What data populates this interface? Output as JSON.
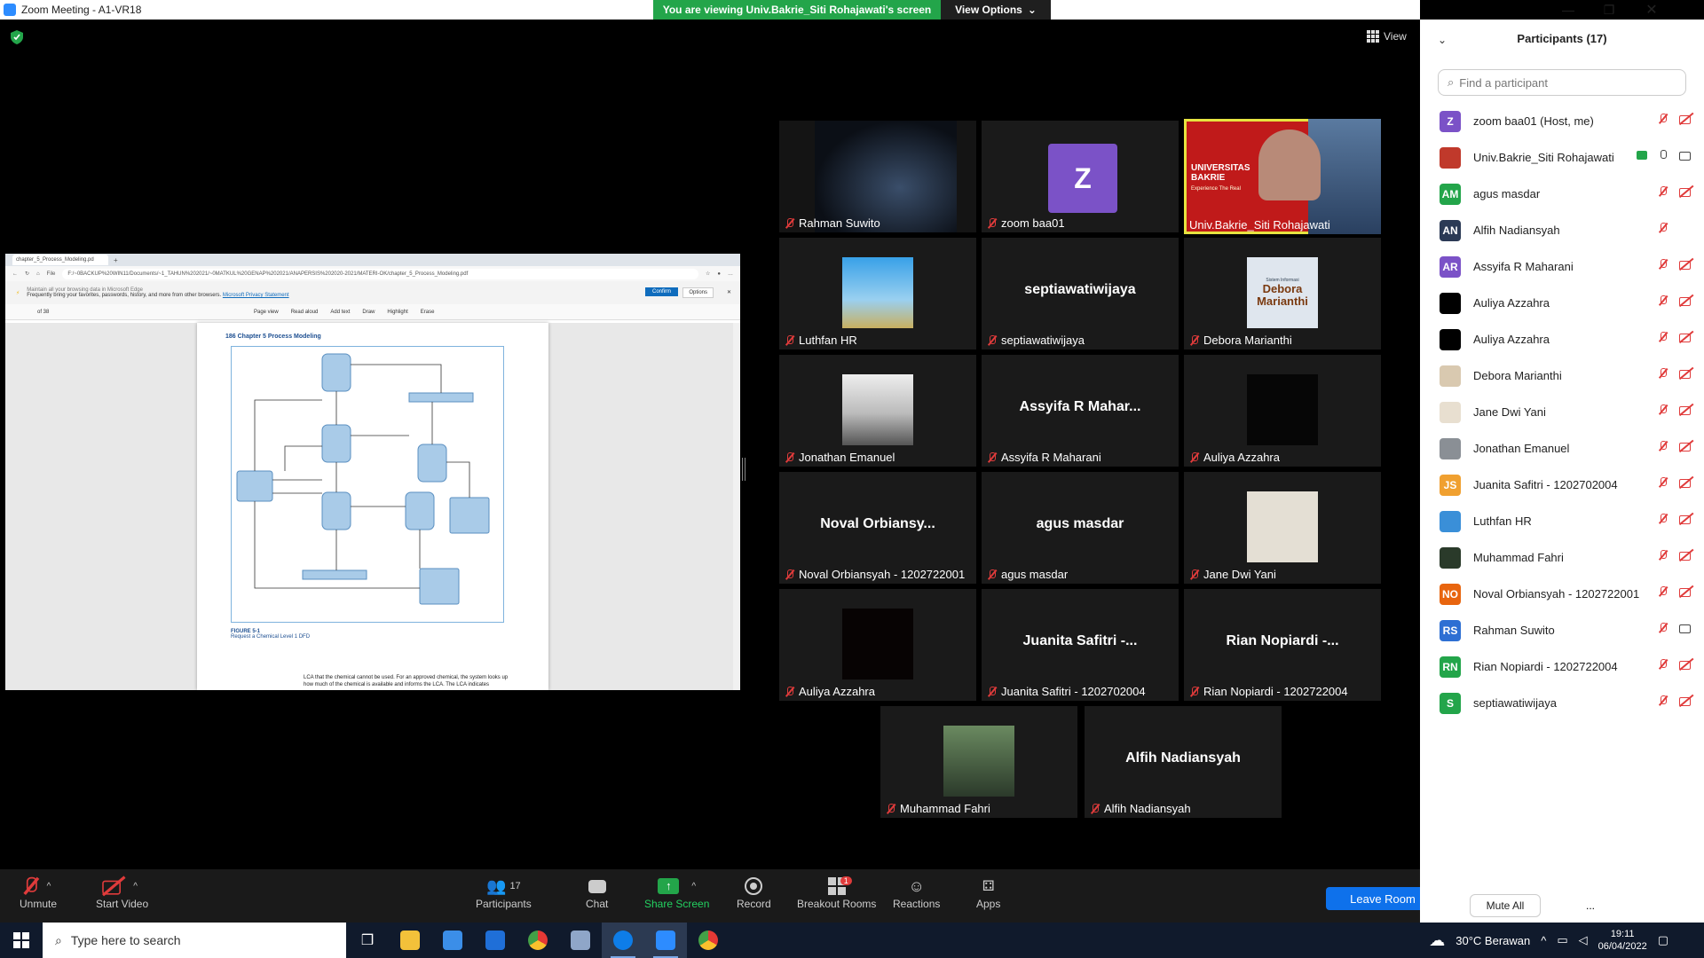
{
  "window": {
    "title": "Zoom Meeting - A1-VR18"
  },
  "banner": {
    "viewing": "You are viewing Univ.Bakrie_Siti Rohajawati's screen",
    "view_options": "View Options"
  },
  "view_button": "View",
  "shared_screen": {
    "tab_title": "chapter_5_Process_Modeling.pd",
    "file_label": "File",
    "url": "F:/~0BACKUP%20WIN11/Documents/~1_TAHUN%202021/~0MATKUL%20GENAP%202021/ANAPERSIS%202020-2021/MATERI-OK/chapter_5_Process_Modeling.pdf",
    "notice_small": "Maintain all your browsing data in Microsoft Edge",
    "notice_main": "Frequently bring your favorites, passwords, history, and more from other browsers.",
    "notice_link": "Microsoft Privacy Statement",
    "confirm": "Confirm",
    "options": "Options",
    "page_of": "of 38",
    "tools": [
      "Page view",
      "Read aloud",
      "Add text",
      "Draw",
      "Highlight",
      "Erase"
    ],
    "page_header": "186   Chapter 5  Process Modeling",
    "figure_title": "FIGURE 5-1",
    "figure_sub": "Request a Chemical Level 1 DFD",
    "body_text": "LCA that the chemical cannot be used. For an approved chemical, the system looks up how much of the chemical is available and informs the LCA. The LCA indicates"
  },
  "tiles": [
    {
      "name": "Rahman Suwito",
      "big": ""
    },
    {
      "name": "zoom baa01",
      "big": "Z"
    },
    {
      "name": "Univ.Bakrie_Siti Rohajawati",
      "big": ""
    },
    {
      "name": "Luthfan HR",
      "big": ""
    },
    {
      "name": "septiawatiwijaya",
      "big": "septiawatiwijaya"
    },
    {
      "name": "Debora Marianthi",
      "big": ""
    },
    {
      "name": "Jonathan Emanuel",
      "big": ""
    },
    {
      "name": "Assyifa R Maharani",
      "big": "Assyifa R Mahar..."
    },
    {
      "name": "Auliya Azzahra",
      "big": ""
    },
    {
      "name": "Noval Orbiansyah - 1202722001",
      "big": "Noval  Orbiansy..."
    },
    {
      "name": "agus masdar",
      "big": "agus masdar"
    },
    {
      "name": "Jane Dwi Yani",
      "big": ""
    },
    {
      "name": "Auliya Azzahra",
      "big": ""
    },
    {
      "name": "Juanita Safitri - 1202702004",
      "big": "Juanita Safitri -..."
    },
    {
      "name": "Rian Nopiardi - 1202722004",
      "big": "Rian  Nopiardi  -..."
    },
    {
      "name": "Muhammad Fahri",
      "big": ""
    },
    {
      "name": "Alfih Nadiansyah",
      "big": "Alfih Nadiansyah"
    }
  ],
  "tile_texts": {
    "univ": "UNIVERSITAS BAKRIE",
    "univ_sub": "Experience The Real",
    "debora": "Debora Marianthi",
    "debora_top": "Sistem Informasi"
  },
  "toolbar": {
    "unmute": "Unmute",
    "start_video": "Start Video",
    "participants": "Participants",
    "participants_count": "17",
    "chat": "Chat",
    "share": "Share Screen",
    "record": "Record",
    "breakout": "Breakout Rooms",
    "breakout_badge": "1",
    "reactions": "Reactions",
    "apps": "Apps",
    "leave": "Leave Room"
  },
  "panel": {
    "title": "Participants (17)",
    "search_placeholder": "Find a participant",
    "mute_all": "Mute All",
    "more": "...",
    "participants": [
      {
        "name": "zoom baa01 (Host, me)",
        "initials": "Z",
        "color": "#7b52c7",
        "mic": "off",
        "cam": "off"
      },
      {
        "name": "Univ.Bakrie_Siti Rohajawati",
        "initials": "",
        "color": "#c0392b",
        "mic": "on",
        "cam": "on",
        "sharing": true
      },
      {
        "name": "agus masdar",
        "initials": "AM",
        "color": "#23a54a",
        "mic": "off",
        "cam": "off"
      },
      {
        "name": "Alfih Nadiansyah",
        "initials": "AN",
        "color": "#2b3a55",
        "mic": "off",
        "cam": "none"
      },
      {
        "name": "Assyifa R Maharani",
        "initials": "AR",
        "color": "#7b52c7",
        "mic": "off",
        "cam": "off"
      },
      {
        "name": "Auliya Azzahra",
        "initials": "",
        "color": "#000000",
        "mic": "off",
        "cam": "off"
      },
      {
        "name": "Auliya Azzahra",
        "initials": "",
        "color": "#000000",
        "mic": "off",
        "cam": "off"
      },
      {
        "name": "Debora Marianthi",
        "initials": "",
        "color": "#d9c9b0",
        "mic": "off",
        "cam": "off"
      },
      {
        "name": "Jane Dwi Yani",
        "initials": "",
        "color": "#e8dfd0",
        "mic": "off",
        "cam": "off"
      },
      {
        "name": "Jonathan Emanuel",
        "initials": "",
        "color": "#8a8f95",
        "mic": "off",
        "cam": "off"
      },
      {
        "name": "Juanita Safitri - 1202702004",
        "initials": "JS",
        "color": "#f0a030",
        "mic": "off",
        "cam": "off"
      },
      {
        "name": "Luthfan HR",
        "initials": "",
        "color": "#3a8fd8",
        "mic": "off",
        "cam": "off"
      },
      {
        "name": "Muhammad Fahri",
        "initials": "",
        "color": "#2a3a2a",
        "mic": "off",
        "cam": "off"
      },
      {
        "name": "Noval Orbiansyah - 1202722001",
        "initials": "NO",
        "color": "#e8650f",
        "mic": "off",
        "cam": "off"
      },
      {
        "name": "Rahman Suwito",
        "initials": "RS",
        "color": "#2d6fd3",
        "mic": "off",
        "cam": "on"
      },
      {
        "name": "Rian Nopiardi - 1202722004",
        "initials": "RN",
        "color": "#23a54a",
        "mic": "off",
        "cam": "off"
      },
      {
        "name": "septiawatiwijaya",
        "initials": "S",
        "color": "#23a54a",
        "mic": "off",
        "cam": "off"
      }
    ]
  },
  "taskbar": {
    "search": "Type here to search",
    "weather": "30°C  Berawan",
    "time": "19:11",
    "date": "06/04/2022"
  }
}
